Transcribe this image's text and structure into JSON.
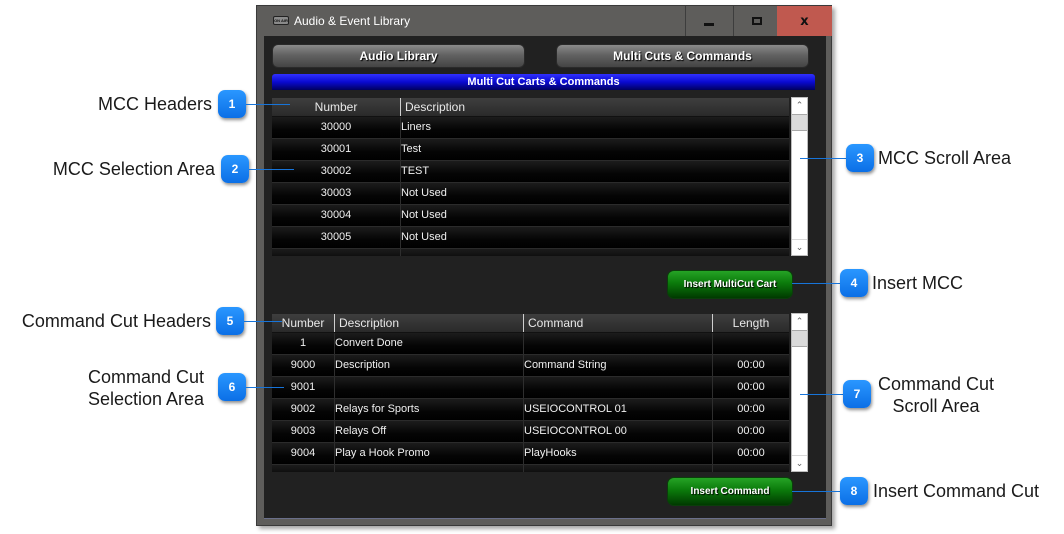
{
  "window": {
    "title": "Audio & Event Library",
    "title_icon": "on-air-icon",
    "controls": {
      "minimize": "minimize-icon",
      "maximize": "maximize-icon",
      "close_label": "x"
    }
  },
  "tabs": [
    {
      "label": "Audio Library"
    },
    {
      "label": "Multi Cuts & Commands"
    }
  ],
  "section_title": "Multi Cut Carts & Commands",
  "mcc_grid": {
    "headers": [
      "Number",
      "Description"
    ],
    "rows": [
      {
        "number": "30000",
        "description": "Liners"
      },
      {
        "number": "30001",
        "description": "Test"
      },
      {
        "number": "30002",
        "description": "TEST"
      },
      {
        "number": "30003",
        "description": "Not Used"
      },
      {
        "number": "30004",
        "description": "Not Used"
      },
      {
        "number": "30005",
        "description": "Not Used"
      }
    ],
    "scrollbar": {
      "up": "^",
      "down": "v"
    }
  },
  "insert_mcc_label": "Insert MultiCut Cart",
  "cmd_grid": {
    "headers": [
      "Number",
      "Description",
      "Command",
      "Length"
    ],
    "rows": [
      {
        "number": "1",
        "description": "Convert Done",
        "command": "",
        "length": ""
      },
      {
        "number": "9000",
        "description": "Description",
        "command": "Command String",
        "length": "00:00"
      },
      {
        "number": "9001",
        "description": "",
        "command": "",
        "length": "00:00"
      },
      {
        "number": "9002",
        "description": "Relays for Sports",
        "command": "USEIOCONTROL 01",
        "length": "00:00"
      },
      {
        "number": "9003",
        "description": "Relays Off",
        "command": "USEIOCONTROL 00",
        "length": "00:00"
      },
      {
        "number": "9004",
        "description": "Play a Hook Promo",
        "command": "PlayHooks",
        "length": "00:00"
      }
    ],
    "scrollbar": {
      "up": "^",
      "down": "v"
    }
  },
  "insert_cmd_label": "Insert Command",
  "callouts": [
    {
      "number": "1",
      "label": "MCC Headers"
    },
    {
      "number": "2",
      "label": "MCC Selection Area"
    },
    {
      "number": "3",
      "label": "MCC Scroll Area"
    },
    {
      "number": "4",
      "label": "Insert MCC"
    },
    {
      "number": "5",
      "label": "Command Cut Headers"
    },
    {
      "number": "6",
      "label_line1": "Command Cut",
      "label_line2": "Selection Area"
    },
    {
      "number": "7",
      "label_line1": "Command Cut",
      "label_line2": "Scroll Area"
    },
    {
      "number": "8",
      "label": "Insert Command Cut"
    }
  ],
  "colors": {
    "callout_badge": "#1a84f5",
    "close_button": "#c0594f",
    "banner_blue": "#0a0ad0",
    "insert_green": "#0b7a0b"
  }
}
